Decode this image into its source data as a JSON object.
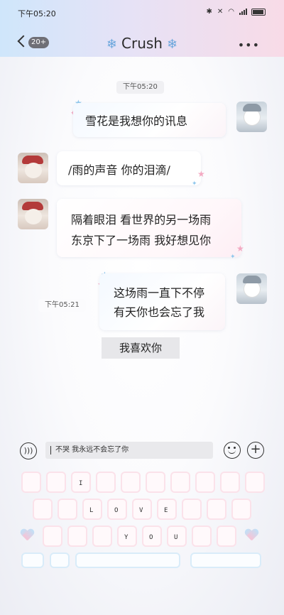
{
  "status_bar": {
    "time": "下午05:20",
    "icons": [
      "bluetooth-icon",
      "mute-icon",
      "wifi-icon",
      "signal-icon",
      "battery-icon"
    ]
  },
  "header": {
    "back_badge": "20+",
    "title": "Crush",
    "title_decoration": "❄"
  },
  "messages": [
    {
      "type": "timestamp",
      "text": "下午05:20"
    },
    {
      "type": "outgoing",
      "lines": [
        "雪花是我想你的讯息"
      ]
    },
    {
      "type": "incoming",
      "lines": [
        "/雨的声音 你的泪滴/"
      ]
    },
    {
      "type": "incoming",
      "lines": [
        "隔着眼泪 看世界的另一场雨",
        "东京下了一场雨 我好想见你"
      ]
    },
    {
      "type": "timestamp",
      "text": "下午05:21"
    },
    {
      "type": "outgoing",
      "lines": [
        "这场雨一直下不停",
        "有天你也会忘了我"
      ]
    },
    {
      "type": "chip",
      "text": "我喜欢你"
    }
  ],
  "input_bar": {
    "value": "不哭 我永远不会忘了你"
  },
  "keyboard": {
    "letters": [
      "I",
      "L",
      "O",
      "V",
      "E",
      "Y",
      "O",
      "U"
    ]
  },
  "colors": {
    "accent_blue": "#8fc7ec",
    "accent_pink": "#f3a9c2"
  }
}
